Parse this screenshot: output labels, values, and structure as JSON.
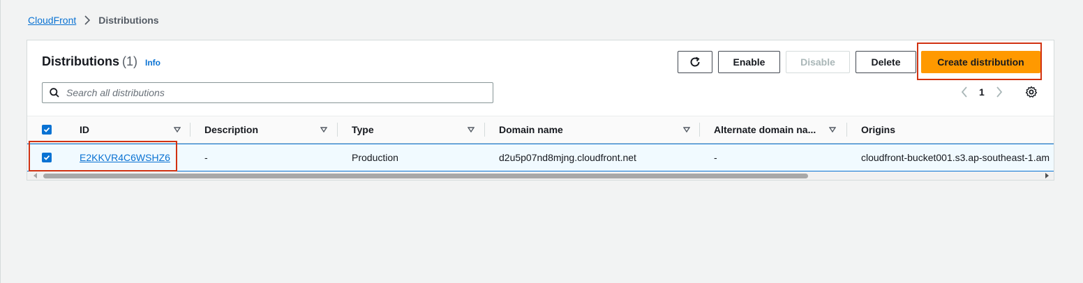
{
  "breadcrumb": {
    "root": "CloudFront",
    "current": "Distributions"
  },
  "panel": {
    "title": "Distributions",
    "count": "(1)",
    "info": "Info"
  },
  "toolbar": {
    "refresh_icon": "refresh-icon",
    "enable": "Enable",
    "disable": "Disable",
    "delete": "Delete",
    "create": "Create distribution"
  },
  "search": {
    "placeholder": "Search all distributions",
    "value": ""
  },
  "pagination": {
    "current_page": "1"
  },
  "table": {
    "columns": [
      "ID",
      "Description",
      "Type",
      "Domain name",
      "Alternate domain na...",
      "Origins"
    ],
    "rows": [
      {
        "selected": true,
        "id": "E2KKVR4C6WSHZ6",
        "description": "-",
        "type": "Production",
        "domain_name": "d2u5p07nd8mjng.cloudfront.net",
        "alternate_domain": "-",
        "origins": "cloudfront-bucket001.s3.ap-southeast-1.am"
      }
    ]
  },
  "colors": {
    "accent": "#0972d3",
    "primary_button": "#ff9900",
    "highlight": "#d13212",
    "background": "#f2f3f3"
  }
}
